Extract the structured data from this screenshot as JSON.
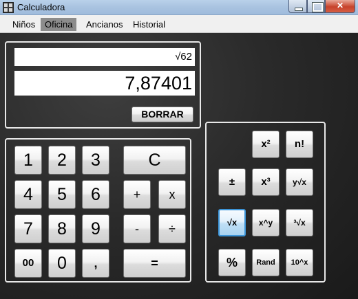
{
  "window": {
    "title": "Calculadora"
  },
  "menu": [
    "Niños",
    "Oficina",
    "Ancianos",
    "Historial"
  ],
  "display": {
    "expression": "√62",
    "result": "7,87401"
  },
  "clear_label": "BORRAR",
  "keypad": {
    "digits": [
      [
        "1",
        "2",
        "3"
      ],
      [
        "4",
        "5",
        "6"
      ],
      [
        "7",
        "8",
        "9"
      ],
      [
        "00",
        "0",
        ","
      ]
    ],
    "clear": "C",
    "plus": "+",
    "multiply": "x",
    "minus": "-",
    "divide": "÷",
    "equals": "="
  },
  "scientific": {
    "square": "x²",
    "factorial": "n!",
    "plusminus": "±",
    "cube": "x³",
    "yroot": "y√x",
    "sqrt": "√x",
    "power": "x^y",
    "cuberoot": "³√x",
    "percent": "%",
    "rand": "Rand",
    "pow10": "10^x"
  }
}
